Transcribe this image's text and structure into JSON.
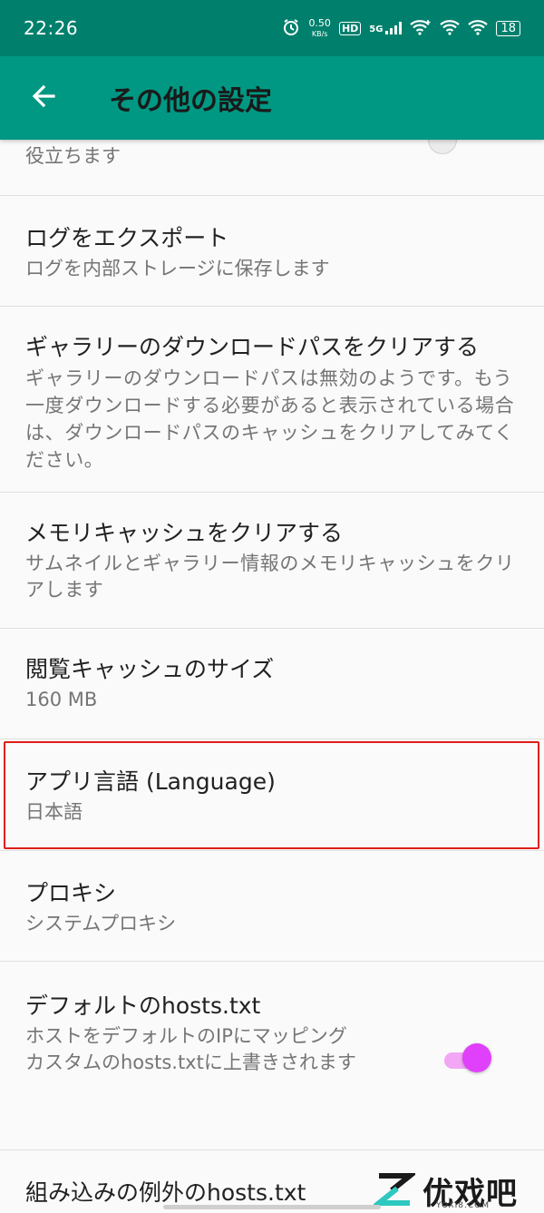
{
  "status_bar": {
    "time": "22:26",
    "speed_value": "0.50",
    "speed_unit": "KB/s",
    "hd_badge": "HD",
    "network": "5G",
    "battery": "18"
  },
  "app_bar": {
    "title": "その他の設定",
    "back_icon": "arrow-left-icon"
  },
  "list": {
    "partial_item": {
      "summary": "役立ちます"
    },
    "items": [
      {
        "title": "ログをエクスポート",
        "summary": "ログを内部ストレージに保存します"
      },
      {
        "title": "ギャラリーのダウンロードパスをクリアする",
        "summary": "ギャラリーのダウンロードパスは無効のようです。もう一度ダウンロードする必要があると表示されている場合は、ダウンロードパスのキャッシュをクリアしてみてください。"
      },
      {
        "title": "メモリキャッシュをクリアする",
        "summary": "サムネイルとギャラリー情報のメモリキャッシュをクリアします"
      },
      {
        "title": "閲覧キャッシュのサイズ",
        "summary": "160 MB"
      },
      {
        "title": "アプリ言語 (Language)",
        "summary": "日本語"
      },
      {
        "title": "プロキシ",
        "summary": "システムプロキシ"
      },
      {
        "title": "デフォルトのhosts.txt",
        "summary": "ホストをデフォルトのIPにマッピング\nカスタムのhosts.txtに上書きされます",
        "toggle_on": true
      },
      {
        "title": "組み込みの例外のhosts.txt"
      }
    ]
  },
  "watermark": {
    "text": "优戏吧",
    "sub": "YOXI8.COM"
  },
  "colors": {
    "status_bar": "#00806c",
    "app_bar": "#009882",
    "toggle_thumb": "#e040fb",
    "toggle_track": "#f3a6f5",
    "highlight": "#e0201a"
  }
}
